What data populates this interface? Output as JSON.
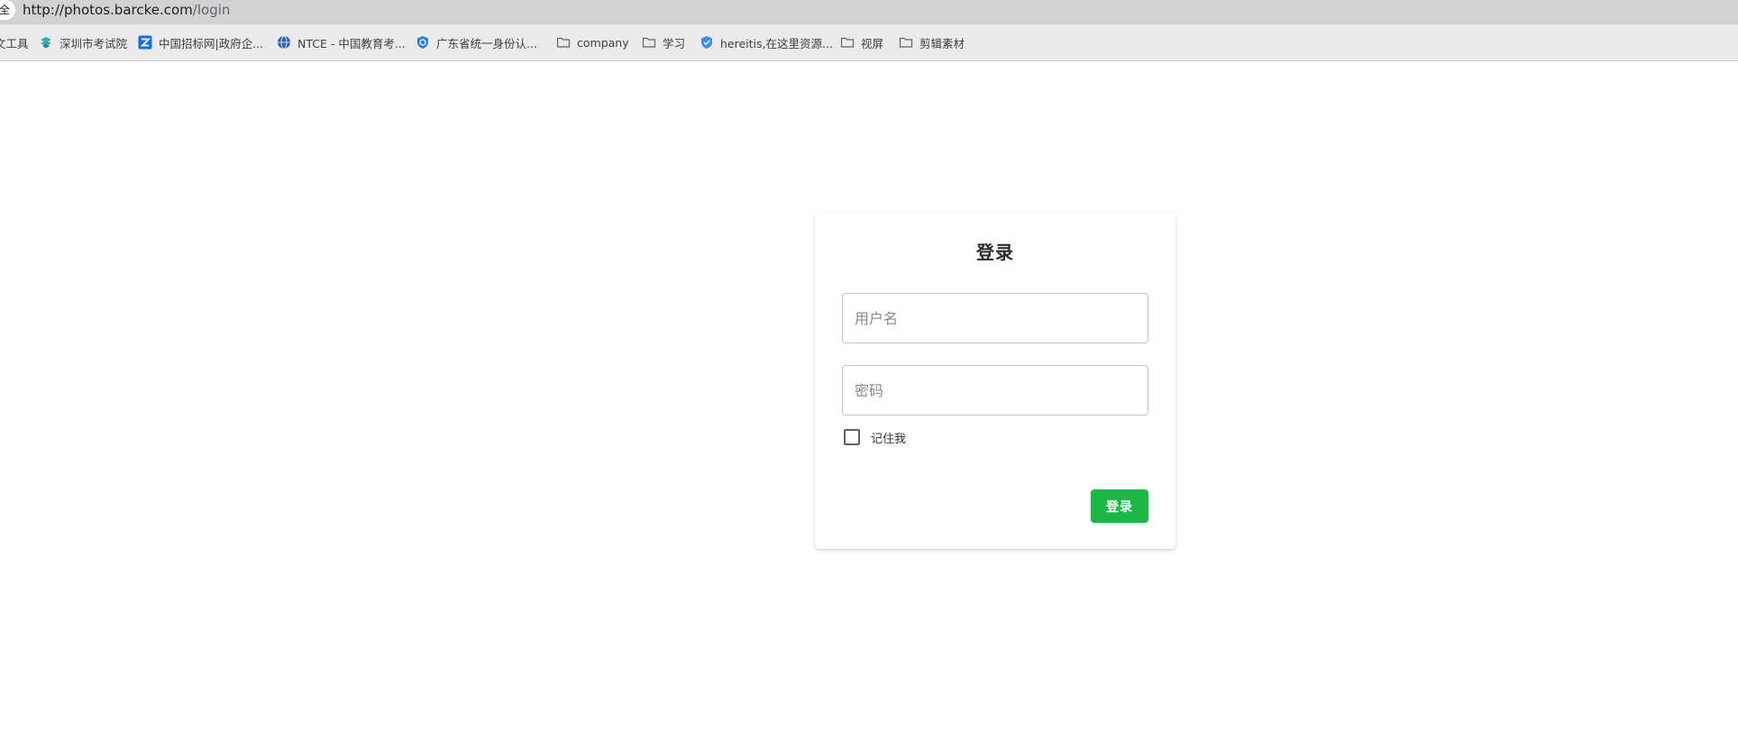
{
  "browser": {
    "security_label": "全",
    "url": {
      "origin": "http://photos.barcke.com",
      "path": "/login"
    }
  },
  "bookmarks": [
    {
      "label": "文工具",
      "icon": "none"
    },
    {
      "label": "深圳市考试院",
      "icon": "szks-logo-icon"
    },
    {
      "label": "中国招标网|政府企...",
      "icon": "z-logo-icon"
    },
    {
      "label": "NTCE - 中国教育考...",
      "icon": "ntce-globe-icon"
    },
    {
      "label": "广东省统一身份认...",
      "icon": "shield-logo-icon"
    },
    {
      "label": "company",
      "icon": "folder-icon"
    },
    {
      "label": "学习",
      "icon": "folder-icon"
    },
    {
      "label": "hereitis,在这里资源...",
      "icon": "shield-badge-icon"
    },
    {
      "label": "视屏",
      "icon": "folder-icon"
    },
    {
      "label": "剪辑素材",
      "icon": "folder-icon"
    }
  ],
  "login": {
    "title": "登录",
    "username": {
      "value": "",
      "placeholder": "用户名"
    },
    "password": {
      "value": "",
      "placeholder": "密码"
    },
    "remember_label": "记住我",
    "remember_checked": false,
    "submit_label": "登录"
  },
  "colors": {
    "primary_button": "#1db748",
    "address_bar": "#d2d2d2",
    "bookmarks_bar": "#ebebeb"
  }
}
